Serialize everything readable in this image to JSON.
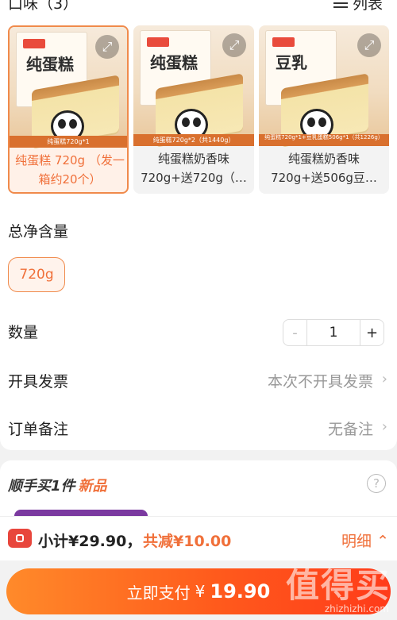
{
  "flavor": {
    "title": "口味（3）",
    "list_view_label": "列表"
  },
  "products": [
    {
      "tag": "纯蛋糕720g*1",
      "name": "纯蛋糕 720g （发一箱约20个）",
      "box_word": "纯蛋糕",
      "selected": true
    },
    {
      "tag": "纯蛋糕720g*2（共1440g）",
      "name": "纯蛋糕奶香味 720g+送720g（…",
      "box_word": "纯蛋糕",
      "selected": false
    },
    {
      "tag": "纯蛋糕720g*1+豆乳蛋糕506g*1（共1226g）",
      "name": "纯蛋糕奶香味 720g+送506g豆…",
      "box_word": "豆乳",
      "selected": false
    }
  ],
  "net_weight": {
    "title": "总净含量",
    "options": [
      "720g"
    ],
    "selected": "720g"
  },
  "quantity": {
    "label": "数量",
    "value": "1",
    "minus": "-",
    "plus": "+"
  },
  "invoice": {
    "label": "开具发票",
    "value": "本次不开具发票"
  },
  "note": {
    "label": "订单备注",
    "value": "无备注"
  },
  "addon": {
    "title": "顺手买1件",
    "badge": "新品",
    "help": "?"
  },
  "summary": {
    "subtotal": "小计¥29.90，",
    "discount": "共减¥10.00",
    "detail": "明细"
  },
  "pay": {
    "label": "立即支付",
    "currency": "¥",
    "amount": "19.90"
  },
  "watermark": {
    "text": "值得买",
    "url": "zhizhizhi.com"
  },
  "colors": {
    "accent": "#f0703a",
    "pay_start": "#ff8a2a",
    "pay_end": "#ff3b1a"
  }
}
